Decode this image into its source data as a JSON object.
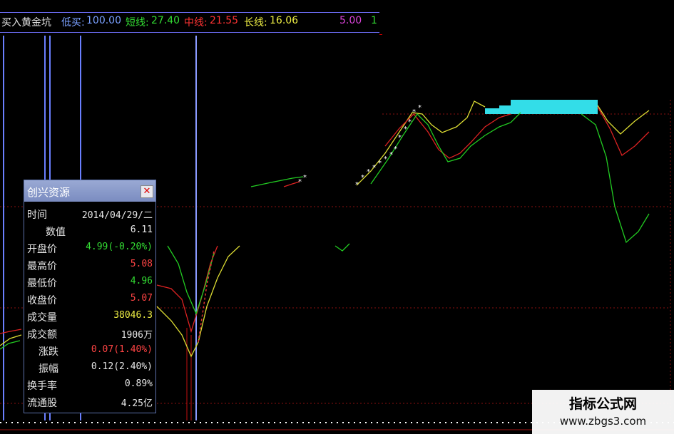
{
  "header": {
    "title": "买入黄金坑",
    "low_buy_label": "低买:",
    "low_buy_value": "100.00",
    "short_label": "短线:",
    "short_value": "27.40",
    "mid_label": "中线:",
    "mid_value": "21.55",
    "long_label": "长线:",
    "long_value": "16.06",
    "extra_value": "5.00",
    "extra_tail": "1",
    "colors": {
      "title": "#e0e0e0",
      "low_buy": "#7aa0ff",
      "short": "#33dd33",
      "mid": "#ff3333",
      "long": "#eeee44",
      "extra": "#dd44dd"
    }
  },
  "info_panel": {
    "title": "创兴资源",
    "close_icon": "close-icon",
    "rows": [
      {
        "key": "时间",
        "value": "2014/04/29/二",
        "color": "#e6e6e6"
      },
      {
        "key": "数值",
        "value": "6.11",
        "color": "#e6e6e6"
      },
      {
        "key": "开盘价",
        "value": "4.99(-0.20%)",
        "color": "#33dd33"
      },
      {
        "key": "最高价",
        "value": "5.08",
        "color": "#ff4444"
      },
      {
        "key": "最低价",
        "value": "4.96",
        "color": "#33dd33"
      },
      {
        "key": "收盘价",
        "value": "5.07",
        "color": "#ff4444"
      },
      {
        "key": "成交量",
        "value": "38046.3",
        "color": "#eeee44"
      },
      {
        "key": "成交额",
        "value": "1906万",
        "color": "#e6e6e6"
      },
      {
        "key": "涨跌",
        "value": "0.07(1.40%)",
        "color": "#ff4444"
      },
      {
        "key": "振幅",
        "value": "0.12(2.40%)",
        "color": "#e6e6e6"
      },
      {
        "key": "换手率",
        "value": "0.89%",
        "color": "#e6e6e6"
      },
      {
        "key": "流通股",
        "value": "4.25亿",
        "color": "#e6e6e6"
      }
    ]
  },
  "watermark": {
    "line1": "指标公式网",
    "line2": "www.zbgs3.com"
  },
  "chart_data": {
    "type": "line",
    "series": [
      {
        "name": "短线",
        "color": "#22cc22"
      },
      {
        "name": "中线",
        "color": "#dd2222"
      },
      {
        "name": "长线",
        "color": "#dddd33"
      }
    ],
    "fill_color": "#33dde8",
    "grid": true
  }
}
